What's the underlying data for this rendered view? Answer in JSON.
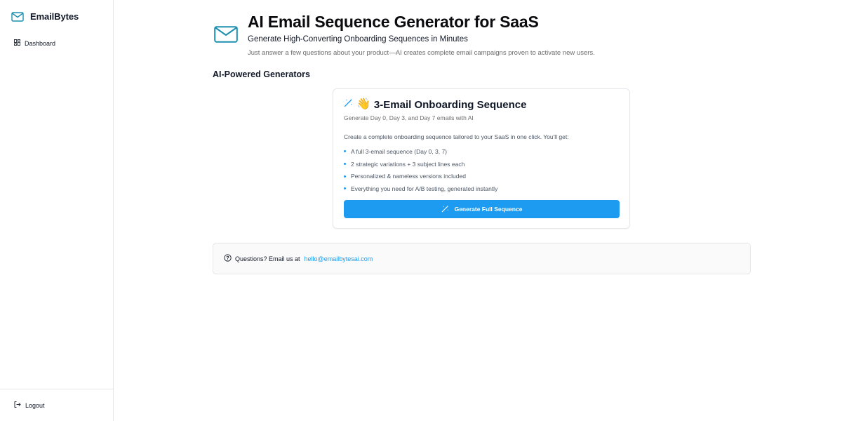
{
  "sidebar": {
    "brand": "EmailBytes",
    "nav": [
      {
        "label": "Dashboard",
        "icon": "dashboard-grid-icon"
      }
    ],
    "logout_label": "Logout"
  },
  "header": {
    "title": "AI Email Sequence Generator for SaaS",
    "subtitle": "Generate High-Converting Onboarding Sequences in Minutes",
    "description": "Just answer a few questions about your product—AI creates complete email campaigns proven to activate new users."
  },
  "section": {
    "heading": "AI-Powered Generators"
  },
  "card": {
    "emoji": "👋",
    "title": "3-Email Onboarding Sequence",
    "subtitle": "Generate Day 0, Day 3, and Day 7 emails with AI",
    "intro": "Create a complete onboarding sequence tailored to your SaaS in one click. You'll get:",
    "bullets": [
      "A full 3-email sequence (Day 0, 3, 7)",
      "2 strategic variations + 3 subject lines each",
      "Personalized & nameless versions included",
      "Everything you need for A/B testing, generated instantly"
    ],
    "button_label": "Generate Full Sequence"
  },
  "contact": {
    "text": "Questions? Email us at",
    "email": "hello@emailbytesai.com"
  },
  "colors": {
    "accent": "#1d9bf0",
    "brand_icon": "#1c8fb0",
    "border": "#e5e7eb"
  }
}
